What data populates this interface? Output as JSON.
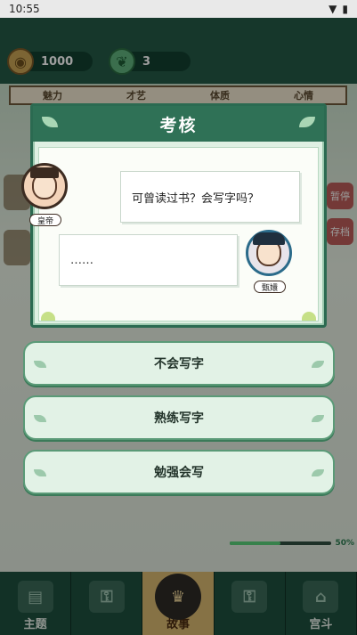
{
  "status_bar": {
    "time": "10:55"
  },
  "resources": {
    "coin_value": "1000",
    "jade_value": "3"
  },
  "stats_strip": {
    "items": [
      "魅力",
      "才艺",
      "体质",
      "心情"
    ]
  },
  "side_buttons": {
    "pause_label": "暂停",
    "save_label": "存档"
  },
  "dialog": {
    "title": "考核",
    "question": "可曾读过书？会写字吗？",
    "answer": "……",
    "speaker_emperor": "皇帝",
    "speaker_player": "甄嬛"
  },
  "choices": [
    {
      "label": "不会写字"
    },
    {
      "label": "熟练写字"
    },
    {
      "label": "勉强会写"
    }
  ],
  "progress": {
    "percent_label": "50%",
    "fraction": 0.5
  },
  "bottom_nav": {
    "items": [
      {
        "label": "主题"
      },
      {
        "label": ""
      },
      {
        "label": "故事"
      },
      {
        "label": ""
      },
      {
        "label": "宫斗"
      }
    ]
  },
  "colors": {
    "accent": "#2f7156",
    "dialog_bg": "#dff0e3",
    "choice_bg": "#e2f2e6"
  }
}
